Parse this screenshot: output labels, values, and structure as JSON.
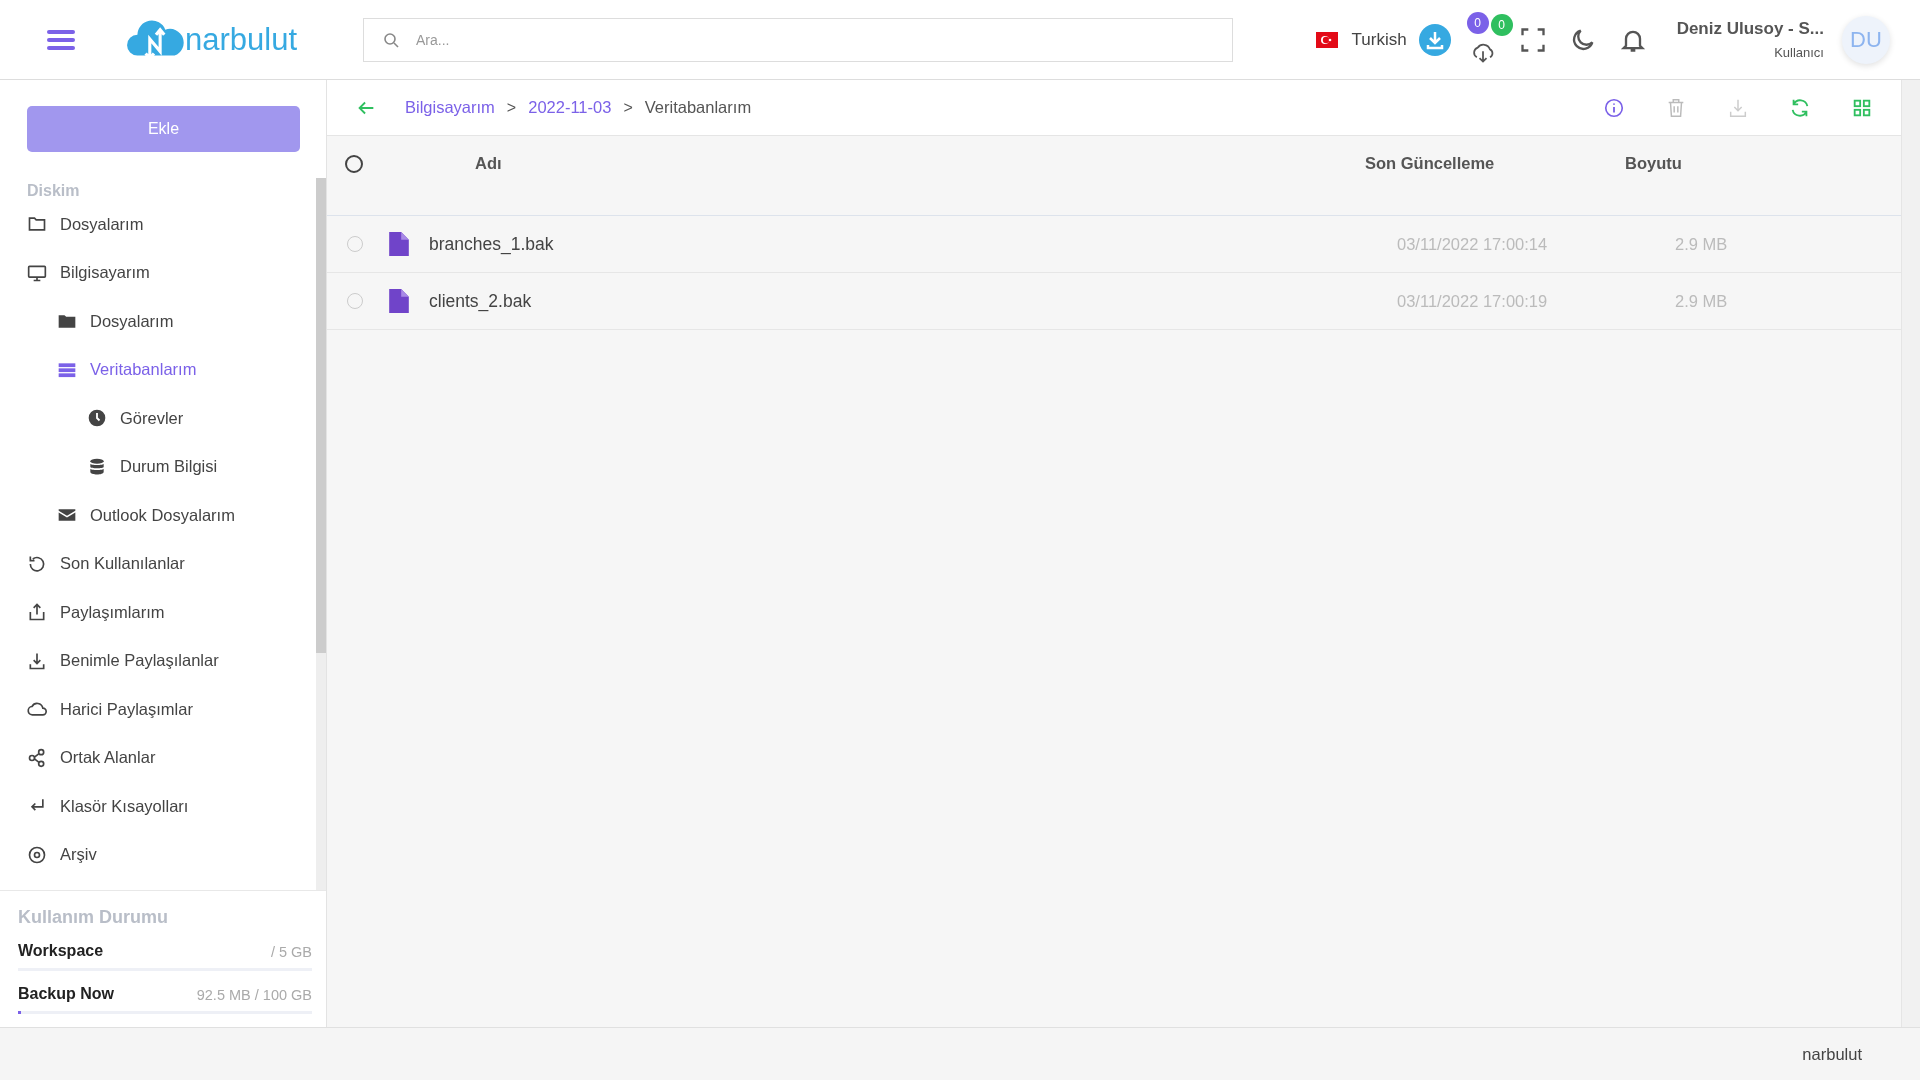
{
  "header": {
    "logo": "narbulut",
    "search": {
      "placeholder": "Ara..."
    },
    "language": "Turkish",
    "badges": [
      {
        "count": "0",
        "color": "#7b61e8"
      },
      {
        "count": "0",
        "color": "#2fbf5f"
      }
    ],
    "user": {
      "name": "Deniz Ulusoy - S...",
      "role": "Kullanıcı",
      "initials": "DU"
    }
  },
  "sidebar": {
    "add_button": "Ekle",
    "section": "Diskim",
    "items": [
      {
        "label": "Dosyalarım",
        "kind": "folder",
        "selected": false
      },
      {
        "label": "Bilgisayarım",
        "kind": "computer",
        "selected": false,
        "children": [
          {
            "label": "Dosyalarım",
            "kind": "folder-solid",
            "selected": false
          },
          {
            "label": "Veritabanlarım",
            "kind": "server",
            "selected": true,
            "children": [
              {
                "label": "Görevler",
                "kind": "clock",
                "selected": false
              },
              {
                "label": "Durum Bilgisi",
                "kind": "database",
                "selected": false
              }
            ]
          },
          {
            "label": "Outlook Dosyalarım",
            "kind": "mail",
            "selected": false
          }
        ]
      },
      {
        "label": "Son Kullanılanlar",
        "kind": "history",
        "selected": false
      },
      {
        "label": "Paylaşımlarım",
        "kind": "upload",
        "selected": false
      },
      {
        "label": "Benimle Paylaşılanlar",
        "kind": "download",
        "selected": false
      },
      {
        "label": "Harici Paylaşımlar",
        "kind": "cloud",
        "selected": false
      },
      {
        "label": "Ortak Alanlar",
        "kind": "share",
        "selected": false
      },
      {
        "label": "Klasör Kısayolları",
        "kind": "return",
        "selected": false
      },
      {
        "label": "Arşiv",
        "kind": "disc",
        "selected": false
      }
    ],
    "usage": {
      "title": "Kullanım Durumu",
      "items": [
        {
          "name": "Workspace",
          "amount": "/ 5 GB"
        },
        {
          "name": "Backup Now",
          "amount": "92.5 MB / 100 GB",
          "level": 0.003
        }
      ]
    }
  },
  "breadcrumb": [
    {
      "label": "Bilgisayarım",
      "current": false
    },
    {
      "separator": ">",
      "label": "2022-11-03",
      "current": false
    },
    {
      "separator": ">",
      "label": "Veritabanlarım",
      "current": true
    }
  ],
  "table": {
    "select_all": {
      "selected": false
    },
    "columns": [
      "Adı",
      "Son Güncelleme",
      "Boyutu"
    ],
    "rows": [
      {
        "name": "branches_1.bak",
        "updated": "03/11/2022 17:00:14",
        "size": "2.9 MB",
        "selected": false
      },
      {
        "name": "clients_2.bak",
        "updated": "03/11/2022 17:00:19",
        "size": "2.9 MB",
        "selected": false
      }
    ]
  },
  "footer": {
    "brand": "narbulut"
  }
}
